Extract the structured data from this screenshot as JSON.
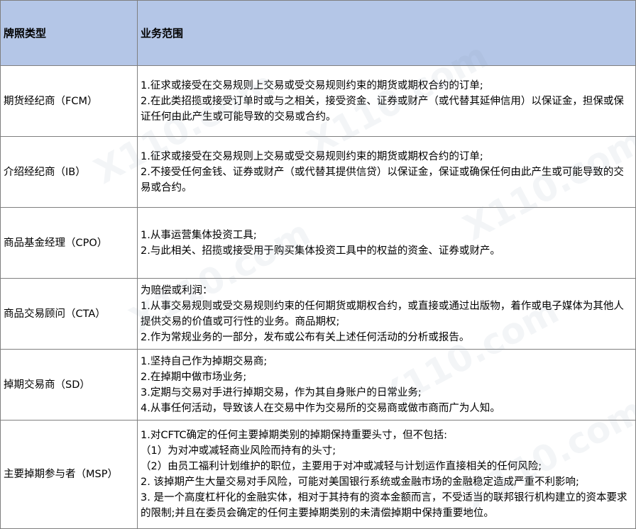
{
  "table": {
    "headers": {
      "license_type": "牌照类型",
      "business_scope": "业务范围"
    },
    "rows": [
      {
        "license": "期货经纪商（FCM）",
        "scope": [
          "1.征求或接受在交易规则上交易或受交易规则约束的期货或期权合约的订单;",
          "2.在此类招揽或接受订单时或与之相关，接受资金、证券或财产（或代替其延伸信用）以保证金，担保或保证任何由此产生或可能导致的交易或合约。"
        ]
      },
      {
        "license": "介绍经纪商（IB）",
        "scope": [
          "1.征求或接受在交易规则上交易或受交易规则约束的期货或期权合约的订单;",
          "2.不接受任何金钱、证券或财产（或代替其提供信贷）以保证金，保证或确保任何由此产生或可能导致的交易或合约。"
        ]
      },
      {
        "license": "商品基金经理（CPO）",
        "scope": [
          "1.从事运营集体投资工具;",
          "2.与此相关、招揽或接受用于购买集体投资工具中的权益的资金、证券或财产。"
        ]
      },
      {
        "license": "商品交易顾问（CTA）",
        "scope": [
          "为赔偿或利润：",
          "1.从事交易规则或受交易规则约束的任何期货或期权合约，或直接或通过出版物，着作或电子媒体为其他人提供交易的价值或可行性的业务。商品期权;",
          "2.作为常规业务的一部分，发布或公布有关上述任何活动的分析或报告。"
        ]
      },
      {
        "license": "掉期交易商（SD）",
        "scope": [
          "1.坚持自己作为掉期交易商;",
          "2.在掉期中做市场业务;",
          "3.定期与交易对手进行掉期交易，作为其自身账户的日常业务;",
          "4.从事任何活动，导致该人在交易中作为交易所的交易商或做市商而广为人知。"
        ]
      },
      {
        "license": "主要掉期参与者（MSP）",
        "scope": [
          "1.对CFTC确定的任何主要掉期类别的掉期保持重要头寸，但不包括:",
          "（1）为对冲或减轻商业风险而持有的头寸;",
          "（2）由员工福利计划维护的职位，主要用于对冲或减轻与计划运作直接相关的任何风险;",
          "2. 该掉期产生大量交易对手风险，可能对美国银行系统或金融市场的金融稳定造成严重不利影响;",
          "3. 是一个高度杠杆化的金融实体，相对于其持有的资本金额而言，不受适当的联邦银行机构建立的资本要求的限制;并且在委员会确定的任何主要掉期类别的未清偿掉期中保持重要地位。"
        ]
      }
    ]
  },
  "colors": {
    "header_background": "#b4c6e7",
    "border": "#7f7f7f",
    "text": "#000000"
  },
  "watermark": {
    "text": "X110.com"
  }
}
